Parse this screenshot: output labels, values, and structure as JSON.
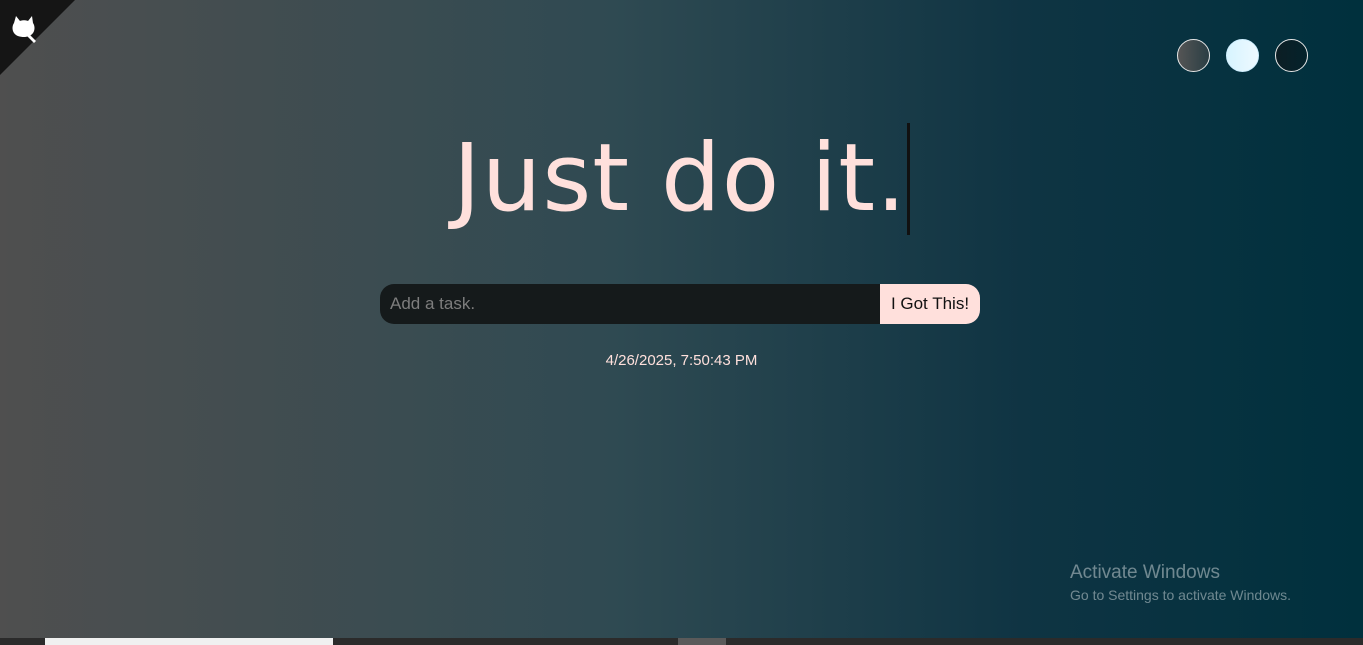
{
  "page": {
    "title": "Just do it."
  },
  "corner": {
    "icon": "github-octocat-icon"
  },
  "themes": [
    {
      "name": "standard-theme",
      "color": "#4a4a4a"
    },
    {
      "name": "light-theme",
      "color": "#dff6ff"
    },
    {
      "name": "darker-theme",
      "color": "#061f26"
    }
  ],
  "task": {
    "placeholder": "Add a task.",
    "value": "",
    "button_label": "I Got This!"
  },
  "datetime": "4/26/2025, 7:50:43 PM",
  "watermark": {
    "title": "Activate Windows",
    "subtitle": "Go to Settings to activate Windows."
  },
  "colors": {
    "accent": "#ffe0dc",
    "input_bg": "#151a1b",
    "bg_left": "#4f4f4f",
    "bg_right": "#00303d"
  }
}
